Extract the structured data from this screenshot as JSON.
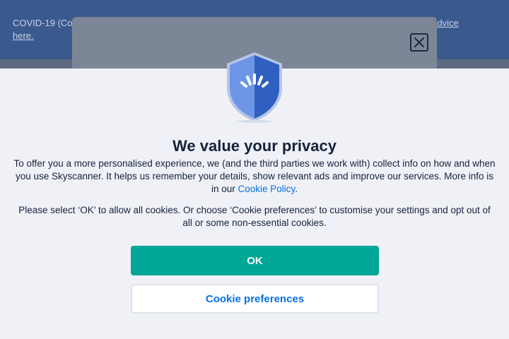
{
  "banner": {
    "left_text": "COVID-19 (Co",
    "right_text": "t advice",
    "link_text": "here."
  },
  "privacy": {
    "title": "We value your privacy",
    "para1_text": "To offer you a more personalised experience, we (and the third parties we work with) collect info on how and when you use Skyscanner. It helps us remember your details, show relevant ads and improve our services. More info is in our ",
    "policy_link": "Cookie Policy",
    "para1_end": ".",
    "para2_text": "Please select ‘OK’ to allow all cookies. Or choose ‘Cookie preferences’ to customise your settings and opt out of all or some non-essential cookies.",
    "ok_label": "OK",
    "prefs_label": "Cookie preferences"
  },
  "icons": {
    "close": "close-icon",
    "shield": "shield-icon"
  },
  "colors": {
    "primary": "#00a698",
    "link": "#0770e3",
    "text": "#15223a",
    "background": "#eff1f7",
    "banner": "#3a5a8e"
  }
}
